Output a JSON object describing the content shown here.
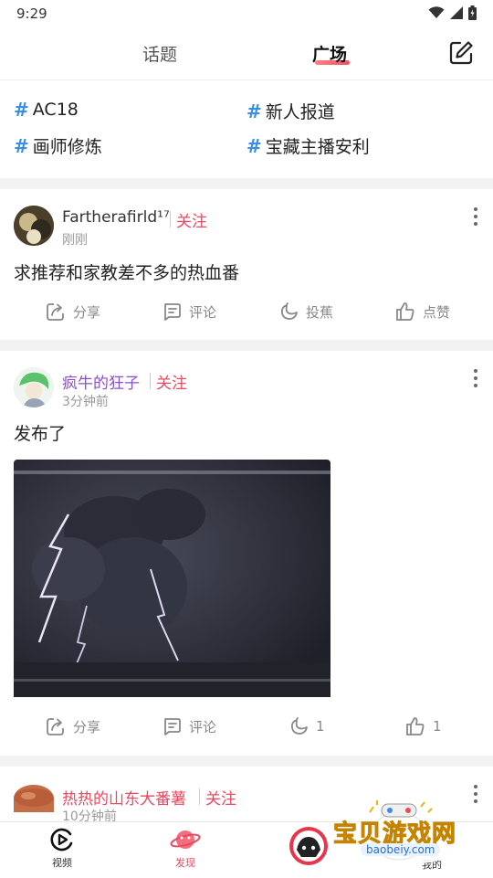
{
  "status_bar": {
    "time": "9:29"
  },
  "header": {
    "tabs": [
      {
        "label": "话题"
      },
      {
        "label": "广场"
      }
    ],
    "active_tab": "广场"
  },
  "topics": [
    "AC18",
    "新人报道",
    "画师修炼",
    "宝藏主播安利"
  ],
  "hash_symbol": "#",
  "posts": [
    {
      "username": "Fartherafirld¹⁷",
      "follow_label": "关注",
      "time": "刚刚",
      "text": "求推荐和家教差不多的热血番",
      "actions": {
        "share": "分享",
        "comment": "评论",
        "banana": "投蕉",
        "like": "点赞"
      }
    },
    {
      "username": "疯牛的狂子",
      "follow_label": "关注",
      "time": "3分钟前",
      "text": "发布了",
      "actions": {
        "share": "分享",
        "comment": "评论",
        "banana": "1",
        "like": "1"
      }
    },
    {
      "username": "热热的山东大番薯",
      "follow_label": "关注",
      "time": "10分钟前"
    }
  ],
  "bottom_nav": [
    {
      "label": "视频"
    },
    {
      "label": "发现"
    },
    {
      "label": "我的"
    }
  ],
  "watermark": {
    "title": "宝贝游戏网",
    "url": "baobeiy.com"
  },
  "colors": {
    "accent": "#e84a5f",
    "hashtag": "#3a8ee6",
    "purple_name": "#8a4fc9"
  }
}
